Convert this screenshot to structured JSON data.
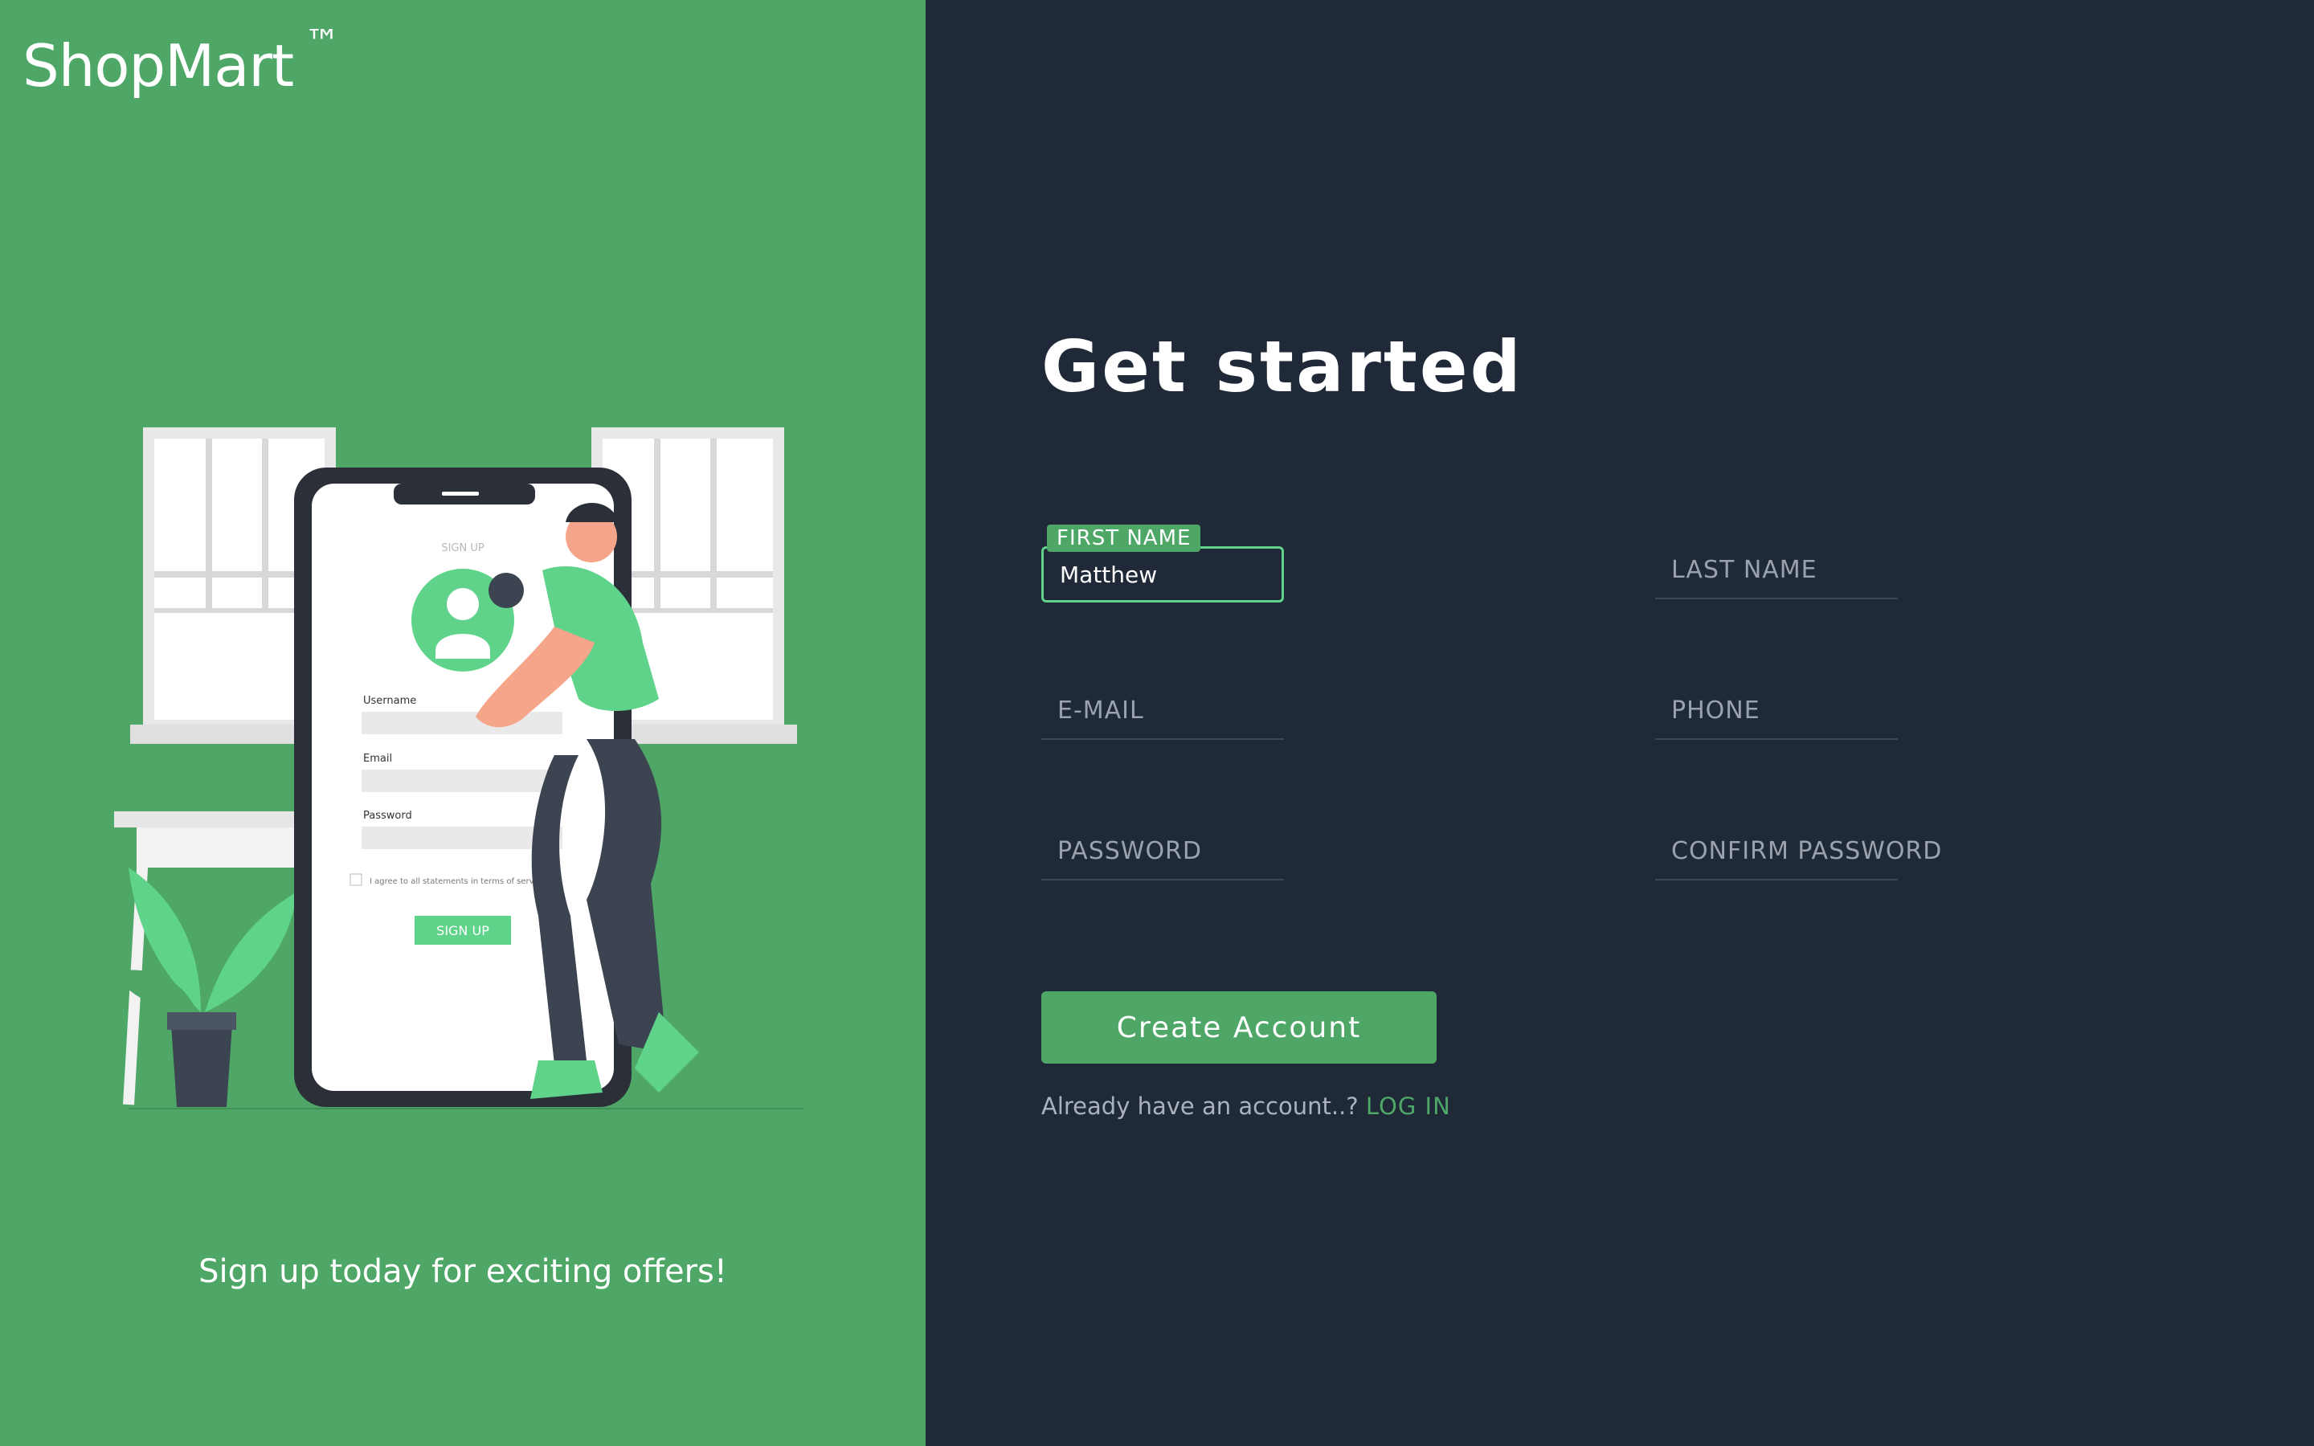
{
  "brand": {
    "name": "ShopMart",
    "trademark": "™"
  },
  "tagline": "Sign up today for exciting offers!",
  "illustration": {
    "phone_title": "SIGN UP",
    "username_label": "Username",
    "email_label": "Email",
    "password_label": "Password",
    "agree_text": "I agree to all statements in terms of service",
    "signup_button": "SIGN UP"
  },
  "form": {
    "title": "Get started",
    "fields": {
      "first_name": {
        "label": "FIRST NAME",
        "value": "Matthew"
      },
      "last_name": {
        "label": "LAST NAME"
      },
      "email": {
        "label": "E-MAIL"
      },
      "phone": {
        "label": "PHONE"
      },
      "password": {
        "label": "PASSWORD"
      },
      "confirm_password": {
        "label": "CONFIRM PASSWORD"
      }
    },
    "submit_label": "Create Account",
    "login_prompt": "Already have an account..?",
    "login_link": "LOG IN"
  },
  "colors": {
    "accent": "#4ea767",
    "panel": "#1f2937",
    "focus": "#5fd38a"
  }
}
